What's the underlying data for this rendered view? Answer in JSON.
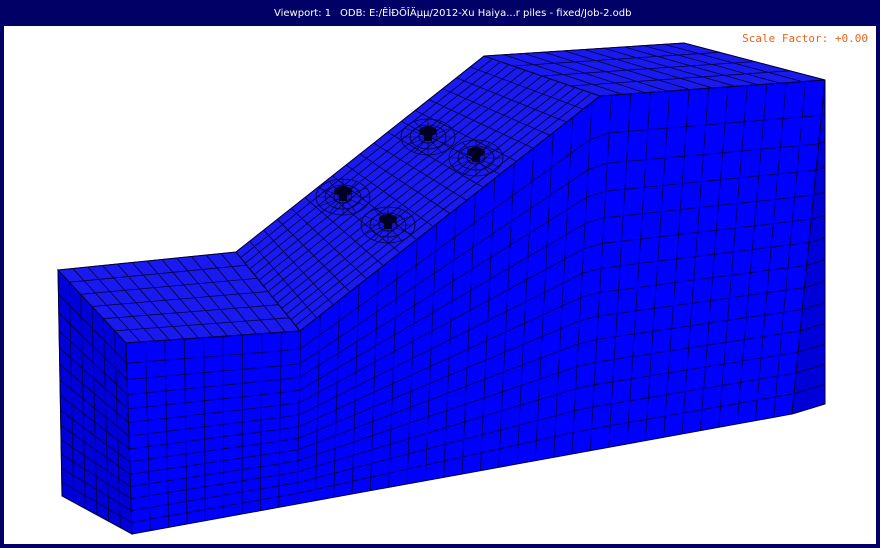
{
  "window": {
    "viewport_label": "Viewport: 1",
    "odb_label": "ODB: E:/ÊÌÐÕÎÄµµ/2012-Xu Haiya...r piles - fixed/Job-2.odb"
  },
  "viewport": {
    "scale_factor": "Scale Factor: +0.00"
  },
  "colors": {
    "background": "#000066",
    "mesh_face": "#0000ff",
    "mesh_face_shaded": "#0000d8",
    "mesh_top": "#1a1aee",
    "mesh_line": "#00003a",
    "scale_factor_text": "#e8641e"
  },
  "model": {
    "type": "finite-element-mesh",
    "description_icon": "slope-with-piles-mesh",
    "pile_count": 4
  }
}
